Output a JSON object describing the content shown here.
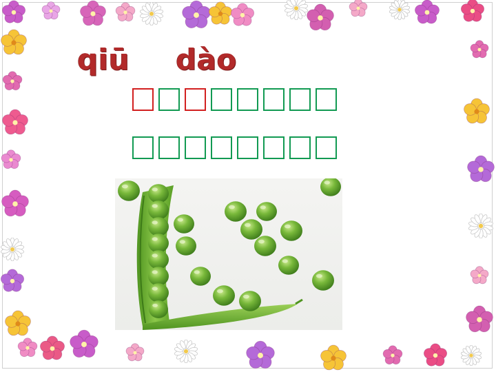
{
  "pinyin": {
    "syllable_1": "qiū",
    "syllable_2": "dào"
  },
  "rows": [
    {
      "boxes": [
        "red",
        "green",
        "red",
        "green",
        "green",
        "green",
        "green",
        "green"
      ]
    },
    {
      "boxes": [
        "green",
        "green",
        "green",
        "green",
        "green",
        "green",
        "green",
        "green"
      ]
    }
  ],
  "colors": {
    "box_green": "#119a52",
    "box_red": "#d21f1f",
    "pinyin": "#b22a2a",
    "pea": "#5aa52a"
  },
  "image": {
    "subject": "peas-in-pod-icon"
  }
}
